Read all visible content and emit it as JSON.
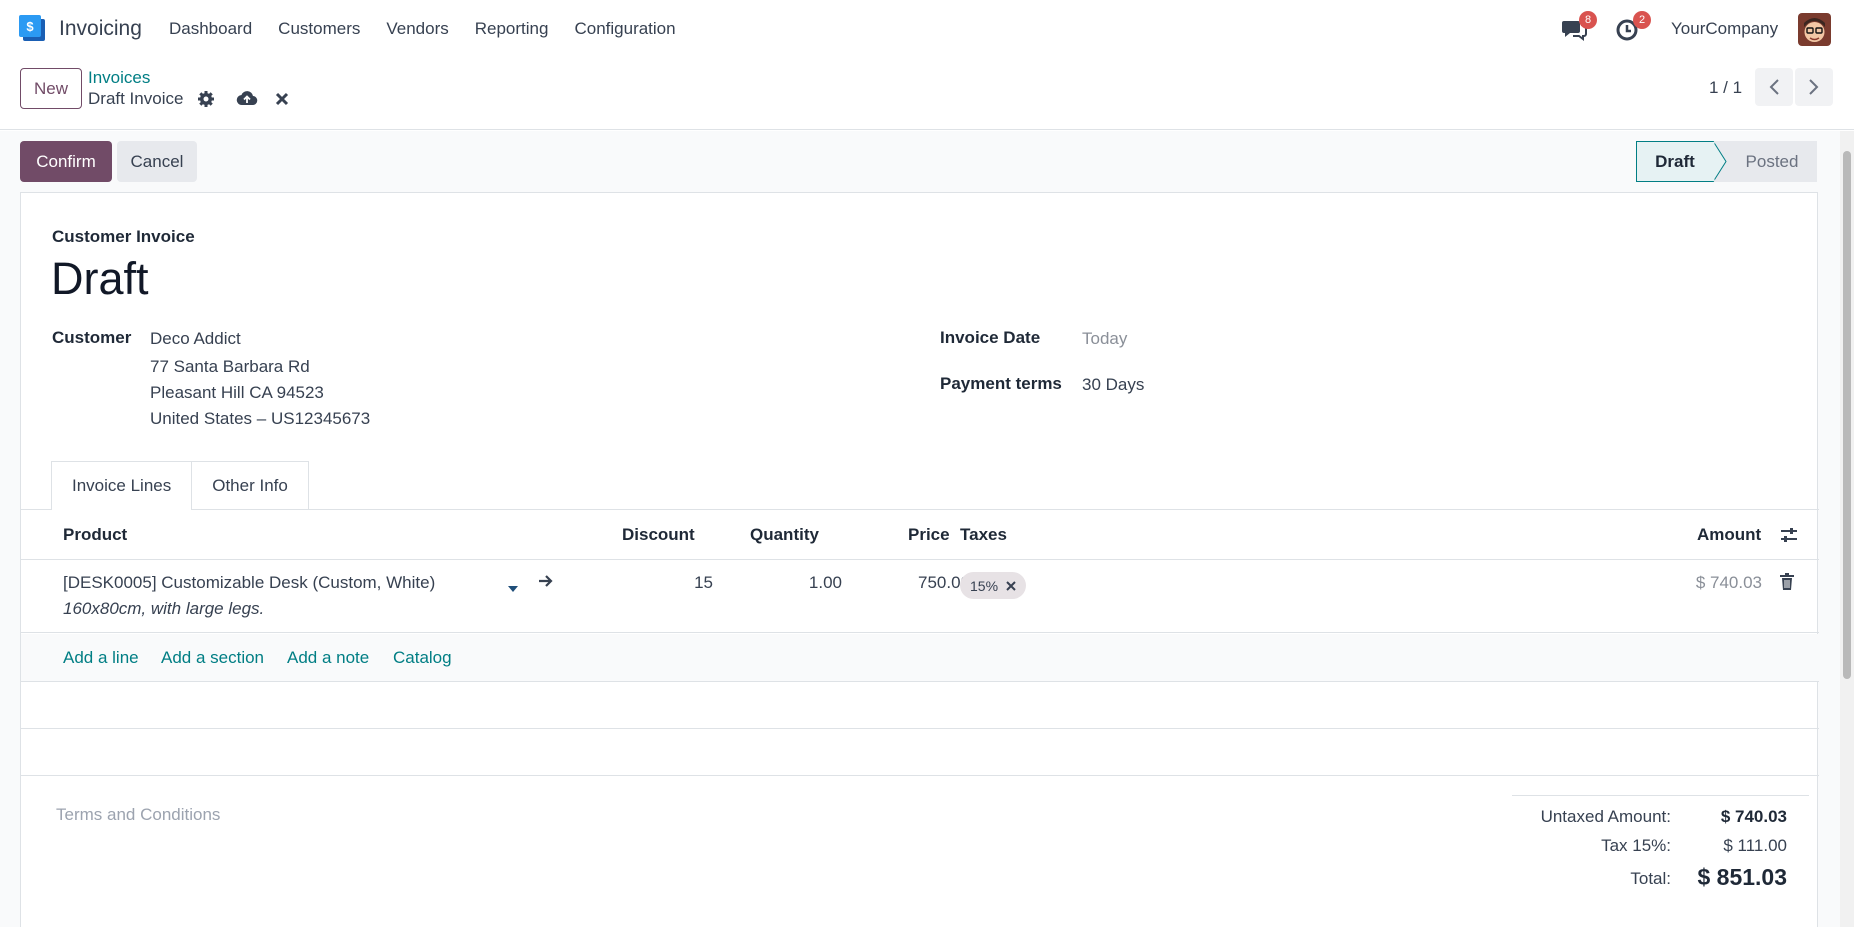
{
  "navbar": {
    "app_name": "Invoicing",
    "menu": [
      "Dashboard",
      "Customers",
      "Vendors",
      "Reporting",
      "Configuration"
    ],
    "messages_count": "8",
    "activities_count": "2",
    "company": "YourCompany"
  },
  "control_panel": {
    "new_label": "New",
    "breadcrumb_parent": "Invoices",
    "breadcrumb_current": "Draft Invoice",
    "pager": "1 / 1"
  },
  "actions": {
    "confirm_label": "Confirm",
    "cancel_label": "Cancel"
  },
  "statusbar": {
    "draft": "Draft",
    "posted": "Posted"
  },
  "form": {
    "move_type": "Customer Invoice",
    "title": "Draft",
    "customer_label": "Customer",
    "customer_name": "Deco Addict",
    "address_line1": "77 Santa Barbara Rd",
    "address_line2": "Pleasant Hill CA 94523",
    "address_line3": "United States – US12345673",
    "invoice_date_label": "Invoice Date",
    "invoice_date_value": "Today",
    "payment_terms_label": "Payment terms",
    "payment_terms_value": "30 Days"
  },
  "tabs": [
    "Invoice Lines",
    "Other Info"
  ],
  "table": {
    "headers": {
      "product": "Product",
      "discount": "Discount",
      "quantity": "Quantity",
      "price": "Price",
      "taxes": "Taxes",
      "amount": "Amount"
    },
    "rows": [
      {
        "product": "[DESK0005] Customizable Desk (Custom, White)",
        "description": "160x80cm, with large legs.",
        "discount": "15",
        "quantity": "1.00",
        "price": "750.00",
        "tax": "15%",
        "amount": "$ 740.03"
      }
    ],
    "add_links": [
      "Add a line",
      "Add a section",
      "Add a note",
      "Catalog"
    ]
  },
  "terms_placeholder": "Terms and Conditions",
  "totals": {
    "untaxed_label": "Untaxed Amount:",
    "untaxed_value": "$ 740.03",
    "tax_label": "Tax 15%:",
    "tax_value": "$ 111.00",
    "total_label": "Total:",
    "total_value": "$ 851.03"
  },
  "colors": {
    "brand": "#714b67",
    "link": "#017e84"
  }
}
